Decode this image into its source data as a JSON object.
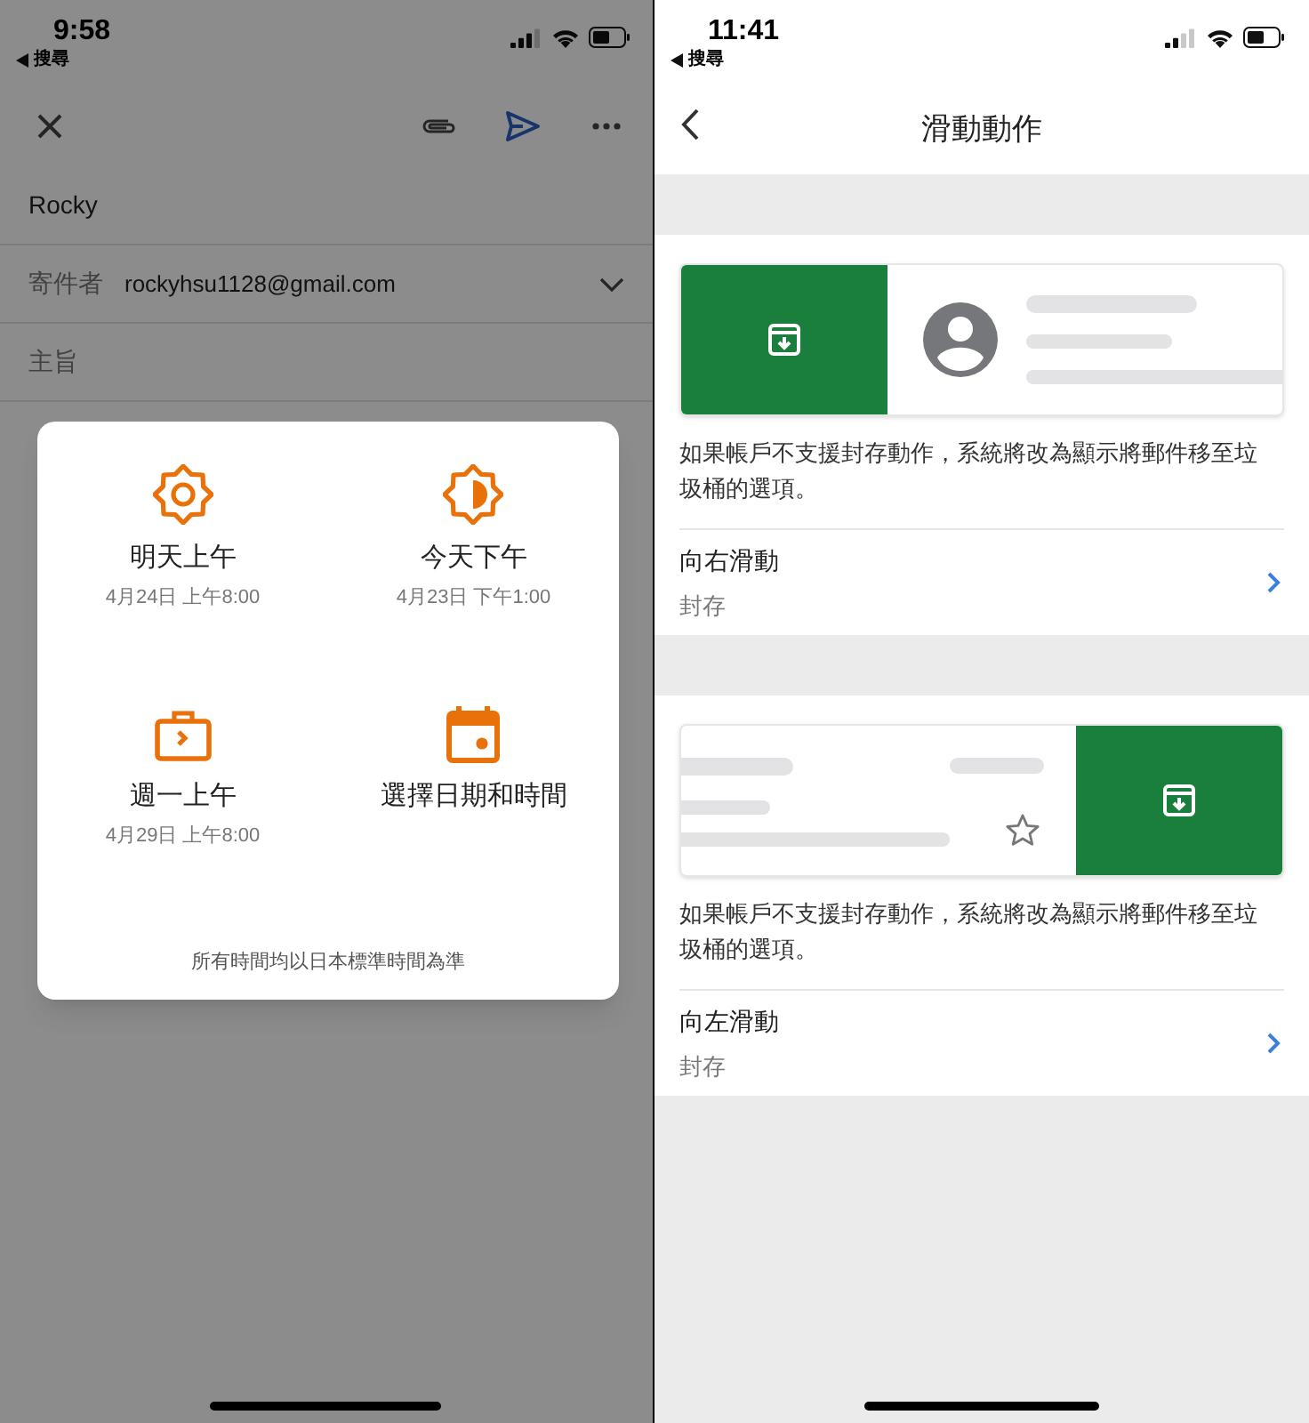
{
  "left_screen": {
    "status_bar": {
      "time": "9:58",
      "back_link": "搜尋"
    },
    "to_field": {
      "value": "Rocky"
    },
    "from_field": {
      "label": "寄件者",
      "value": "rockyhsu1128@gmail.com"
    },
    "subject_field": {
      "placeholder": "主旨"
    },
    "snooze_dialog": {
      "options": [
        {
          "kind": "sun",
          "label": "明天上午",
          "time": "4月24日 上午8:00"
        },
        {
          "kind": "half_sun",
          "label": "今天下午",
          "time": "4月23日 下午1:00"
        },
        {
          "kind": "briefcase",
          "label": "週一上午",
          "time": "4月29日 上午8:00"
        },
        {
          "kind": "calendar",
          "label": "選擇日期和時間"
        }
      ],
      "footer": "所有時間均以日本標準時間為準"
    }
  },
  "right_screen": {
    "status_bar": {
      "time": "11:41",
      "back_link": "搜尋"
    },
    "header": {
      "title": "滑動動作"
    },
    "sections": [
      {
        "kind": "swipe_right",
        "note": "如果帳戶不支援封存動作，系統將改為顯示將郵件移至垃圾桶的選項。",
        "setting": {
          "label": "向右滑動",
          "value": "封存"
        }
      },
      {
        "kind": "swipe_left",
        "note": "如果帳戶不支援封存動作，系統將改為顯示將郵件移至垃圾桶的選項。",
        "setting": {
          "label": "向左滑動",
          "value": "封存"
        }
      }
    ]
  }
}
